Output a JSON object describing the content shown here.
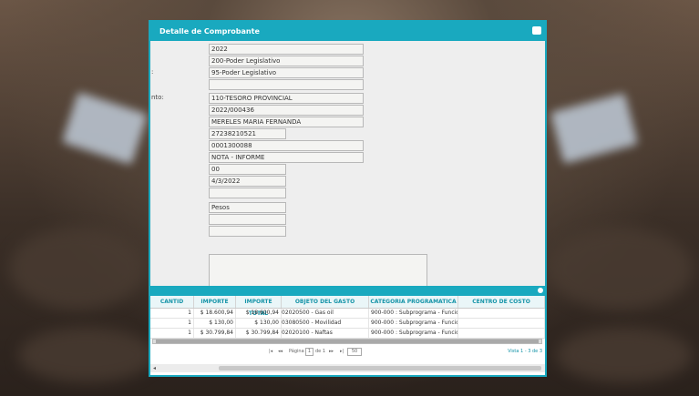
{
  "dialog": {
    "title": "Detalle de Comprobante",
    "fields": [
      {
        "label": "",
        "value": "2022"
      },
      {
        "label": "",
        "value": "200-Poder Legislativo"
      },
      {
        "label": ":",
        "value": "95-Poder Legislativo"
      },
      {
        "label": "",
        "value": ""
      },
      {
        "label": "nto:",
        "value": "110-TESORO PROVINCIAL"
      },
      {
        "label": "",
        "value": "2022/000436"
      },
      {
        "label": "",
        "value": "MERELES MARIA FERNANDA"
      },
      {
        "label": "",
        "value": "27238210521"
      },
      {
        "label": "",
        "value": "0001300088"
      },
      {
        "label": "",
        "value": "NOTA - INFORME"
      },
      {
        "label": "",
        "value": "00"
      },
      {
        "label": "",
        "value": "4/3/2022"
      },
      {
        "label": "",
        "value": ""
      },
      {
        "label": "",
        "value": "Pesos"
      },
      {
        "label": "",
        "value": ""
      },
      {
        "label": "",
        "value": ""
      }
    ]
  },
  "grid": {
    "columns": [
      "CANTID",
      "IMPORTE",
      "IMPORTE TOTAL",
      "OBJETO DEL GASTO",
      "CATEGORIA PROGRAMATICA",
      "CENTRO DE COSTO"
    ],
    "rows": [
      {
        "cantidad": "1",
        "importe": "$ 18.600,94",
        "total": "$ 18.600,94",
        "objeto": "02020500 - Gas oil",
        "categoria": "900-000 : Subprograma - Funcional",
        "centro": ""
      },
      {
        "cantidad": "1",
        "importe": "$ 130,00",
        "total": "$ 130,00",
        "objeto": "03080500 - Movilidad",
        "categoria": "900-000 : Subprograma - Funcional",
        "centro": ""
      },
      {
        "cantidad": "1",
        "importe": "$ 30.799,84",
        "total": "$ 30.799,84",
        "objeto": "02020100 - Naftas",
        "categoria": "900-000 : Subprograma - Funcional",
        "centro": ""
      }
    ],
    "pager": {
      "first": "|◂",
      "prev": "◂◂",
      "page_label": "Página",
      "page_value": "1",
      "of_label": "de 1",
      "next": "▸▸",
      "last": "▸|",
      "page_size": "50",
      "info": "Vista 1 - 3 de 3"
    }
  },
  "colors": {
    "accent": "#19a9bf"
  }
}
